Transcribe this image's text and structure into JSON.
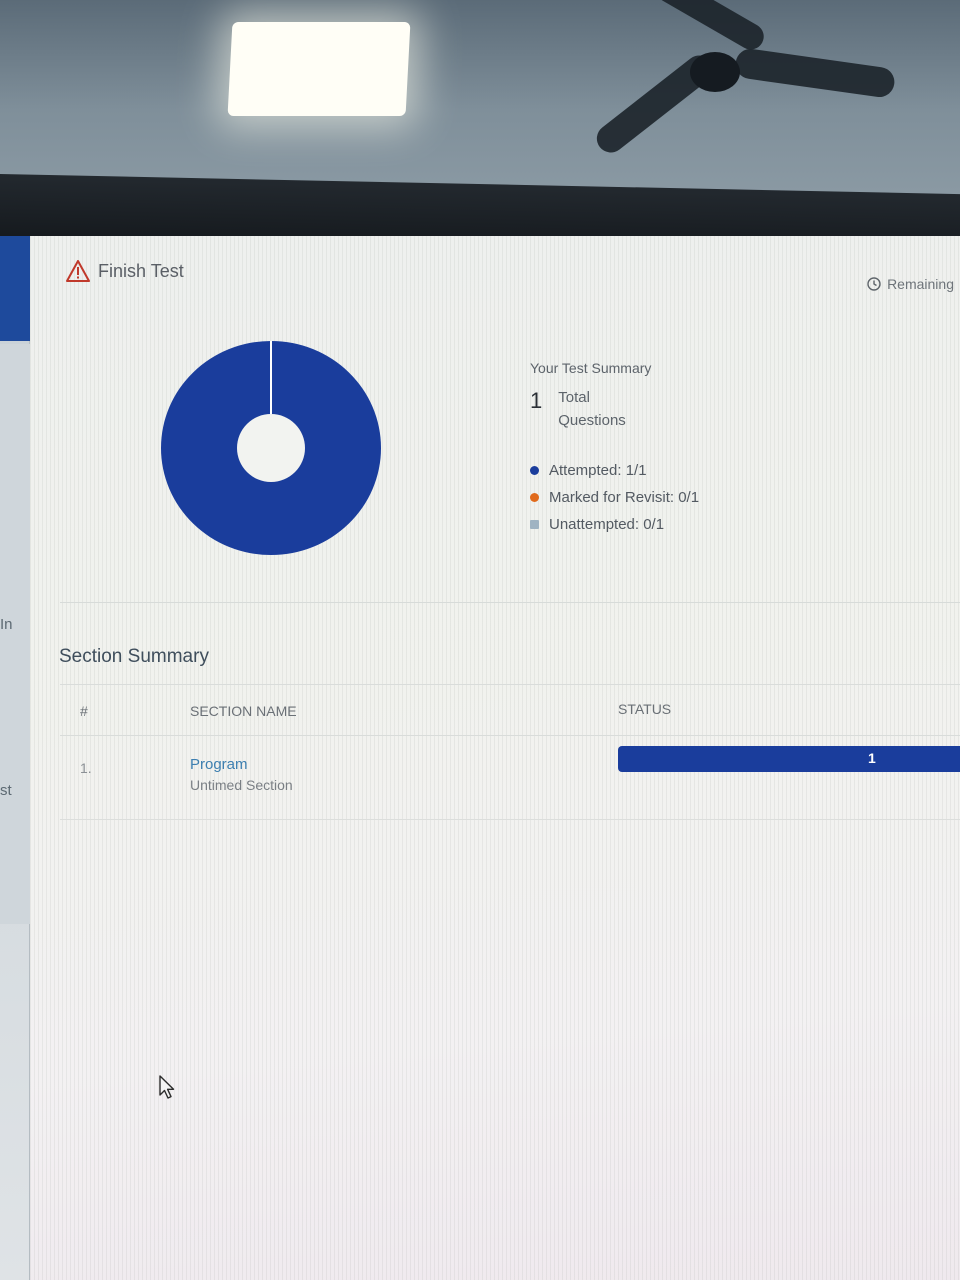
{
  "header": {
    "title": "Finish Test",
    "remaining_label": "Remaining"
  },
  "summary": {
    "title": "Your Test Summary",
    "total_count": "1",
    "total_label": "Total Questions",
    "legend": [
      {
        "label": "Attempted: 1/1",
        "color": "#1a3d9c",
        "value": 1
      },
      {
        "label": "Marked for Revisit: 0/1",
        "color": "#e06a1b",
        "value": 0
      },
      {
        "label": "Unattempted: 0/1",
        "color": "#9fb3c2",
        "value": 0
      }
    ]
  },
  "chart_data": {
    "type": "pie",
    "categories": [
      "Attempted",
      "Marked for Revisit",
      "Unattempted"
    ],
    "values": [
      1,
      0,
      0
    ],
    "colors": [
      "#1a3d9c",
      "#e06a1b",
      "#9fb3c2"
    ]
  },
  "section_summary": {
    "title": "Section Summary",
    "columns": [
      "#",
      "SECTION NAME",
      "STATUS"
    ],
    "rows": [
      {
        "index": "1.",
        "name": "Program",
        "subtitle": "Untimed Section",
        "status_value": "1",
        "status_fraction": 1.0
      }
    ]
  },
  "edge_text": [
    "In",
    "st"
  ],
  "colors": {
    "primary": "#1a3d9c",
    "link": "#3d7fb0",
    "warning": "#c0392b"
  }
}
